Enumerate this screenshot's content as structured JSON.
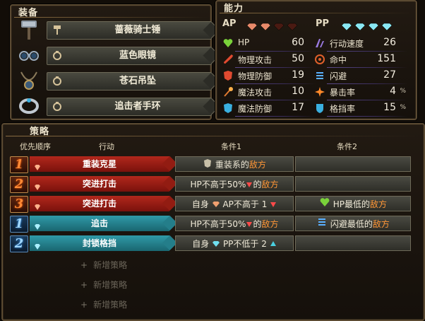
{
  "equipment": {
    "title": "装备",
    "items": [
      {
        "name": "蔷薇骑士锤",
        "icon": "war-hammer-icon",
        "slot_icon": "hammer-slot-icon"
      },
      {
        "name": "蓝色眼镜",
        "icon": "glasses-icon",
        "slot_icon": "ring-slot-icon"
      },
      {
        "name": "苍石吊坠",
        "icon": "pendant-icon",
        "slot_icon": "ring-slot-icon"
      },
      {
        "name": "追击者手环",
        "icon": "bracelet-icon",
        "slot_icon": "ring-slot-icon"
      }
    ]
  },
  "abilities": {
    "title": "能力",
    "ap_label": "AP",
    "pp_label": "PP",
    "ap_gems": {
      "filled": 2,
      "total": 4
    },
    "pp_gems": {
      "filled": 4,
      "total": 4
    },
    "left": [
      {
        "name": "HP",
        "value": "60",
        "icon": "heart-icon",
        "color": "#7ad23a"
      },
      {
        "name": "物理攻击",
        "value": "50",
        "icon": "sword-icon",
        "color": "#e04a30"
      },
      {
        "name": "物理防御",
        "value": "19",
        "icon": "armor-icon",
        "color": "#e04a30"
      },
      {
        "name": "魔法攻击",
        "value": "10",
        "icon": "staff-icon",
        "color": "#e07a30"
      },
      {
        "name": "魔法防御",
        "value": "17",
        "icon": "magic-armor-icon",
        "color": "#3ab0e0"
      }
    ],
    "right": [
      {
        "name": "行动速度",
        "value": "26",
        "unit": "",
        "icon": "speed-icon",
        "color": "#9a7ae0"
      },
      {
        "name": "命中",
        "value": "151",
        "unit": "",
        "icon": "target-icon",
        "color": "#e0602a"
      },
      {
        "name": "闪避",
        "value": "27",
        "unit": "",
        "icon": "evade-icon",
        "color": "#5ab0ff"
      },
      {
        "name": "暴击率",
        "value": "4",
        "unit": "%",
        "icon": "crit-icon",
        "color": "#ff8a2a"
      },
      {
        "name": "格挡率",
        "value": "15",
        "unit": "%",
        "icon": "shield-icon",
        "color": "#3ab0e0"
      }
    ]
  },
  "strategy": {
    "title": "策略",
    "headers": {
      "priority": "优先顺序",
      "action": "行动",
      "cond1": "条件1",
      "cond2": "条件2"
    },
    "rows": [
      {
        "prio": "1",
        "type": "red",
        "action": "重装克星",
        "c1": {
          "pre": "",
          "icon": "armor-class-icon",
          "text": " 重装系的",
          "hl": "敌方",
          "post": ""
        },
        "c2": null
      },
      {
        "prio": "2",
        "type": "red",
        "action": "突进打击",
        "c1": {
          "pre": "HP不高于50%",
          "icon": "down-arrow-icon",
          "text": "的",
          "hl": "敌方",
          "post": ""
        },
        "c2": null
      },
      {
        "prio": "3",
        "type": "red",
        "action": "突进打击",
        "c1": {
          "pre": "自身 ",
          "icon": "ap-gem-icon",
          "text": " AP不高于 1 ",
          "hl": "",
          "post": "",
          "tail_icon": "down-arrow-icon"
        },
        "c2": {
          "icon": "heart-icon",
          "text": " HP最低的",
          "hl": "敌方"
        }
      },
      {
        "prio": "1",
        "type": "teal",
        "action": "追击",
        "c1": {
          "pre": "HP不高于50%",
          "icon": "down-arrow-icon",
          "text": "的",
          "hl": "敌方",
          "post": ""
        },
        "c2": {
          "icon": "evade-icon",
          "text": " 闪避最低的",
          "hl": "敌方"
        }
      },
      {
        "prio": "2",
        "type": "teal",
        "action": "封锁格挡",
        "c1": {
          "pre": "自身 ",
          "icon": "pp-gem-icon",
          "text": " PP不低于 2 ",
          "hl": "",
          "post": "",
          "tail_icon": "up-arrow-icon"
        },
        "c2": null
      }
    ],
    "add_label": "新增策略",
    "add_count": 3
  }
}
